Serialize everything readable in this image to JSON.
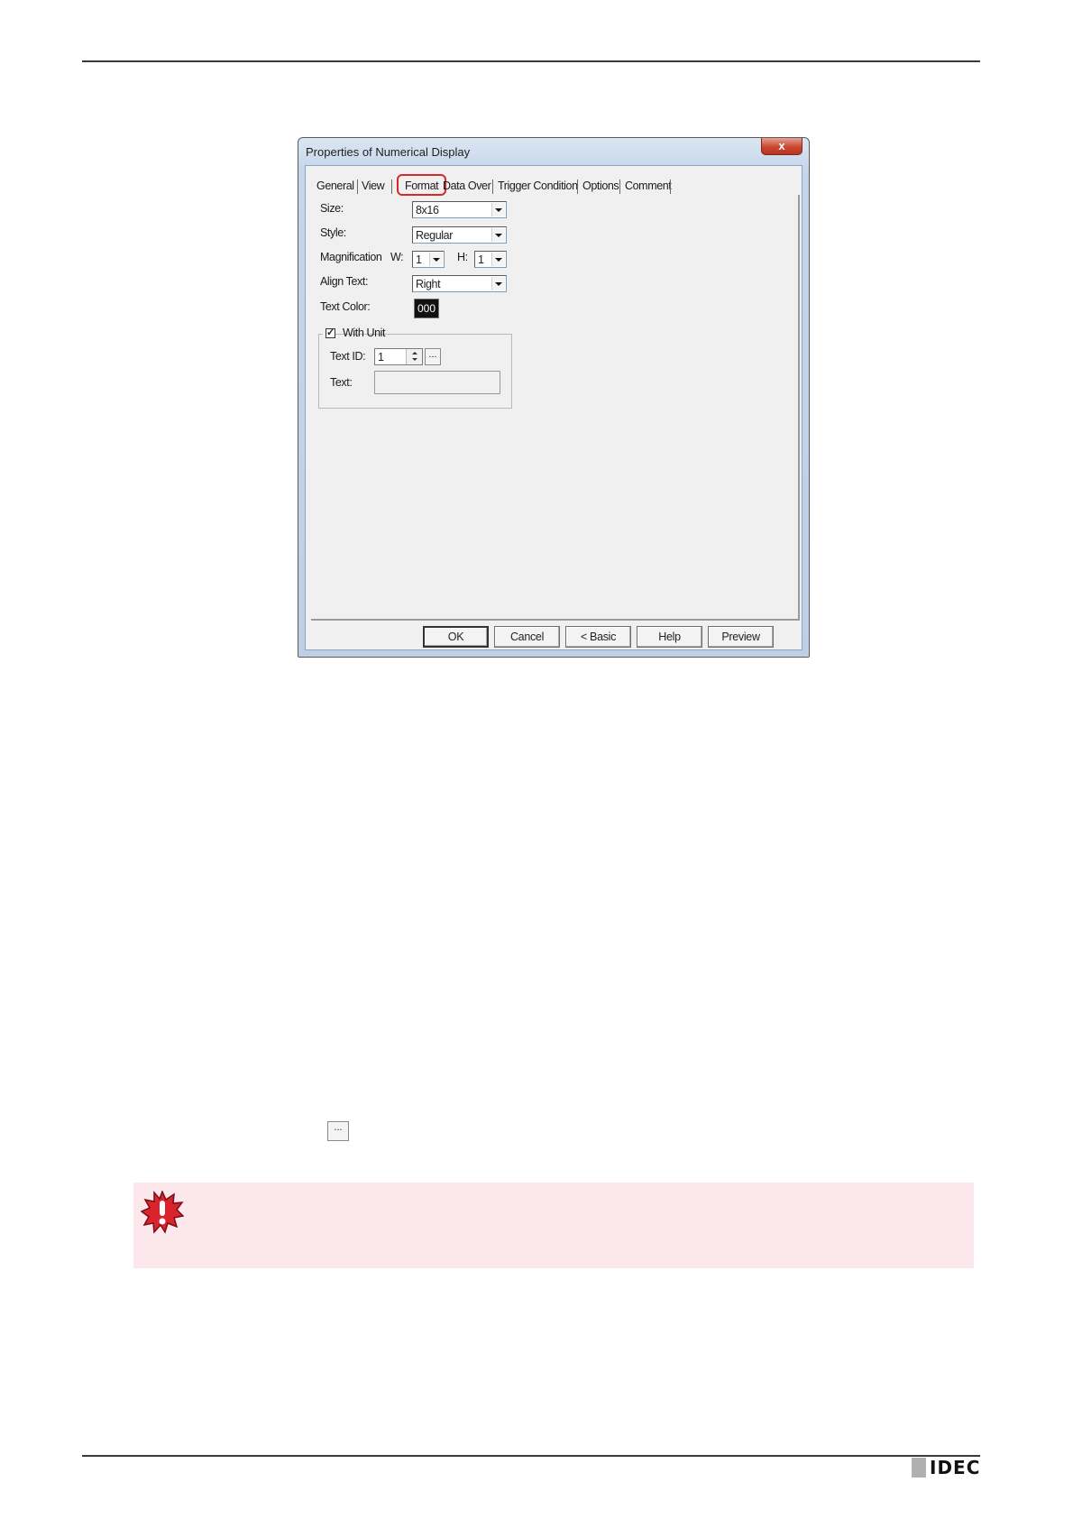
{
  "dialog": {
    "title": "Properties of Numerical Display",
    "close_glyph": "x",
    "tabs": [
      "General",
      "View",
      "Format",
      "Data Over",
      "Trigger Condition",
      "Options",
      "Comment"
    ],
    "active_tab": "Format",
    "size": {
      "label": "Size:",
      "value": "8x16"
    },
    "style": {
      "label": "Style:",
      "value": "Regular"
    },
    "magnification": {
      "label": "Magnification",
      "w_label": "W:",
      "w_value": "1",
      "h_label": "H:",
      "h_value": "1"
    },
    "align_text": {
      "label": "Align Text:",
      "value": "Right"
    },
    "text_color": {
      "label": "Text Color:",
      "value": "000",
      "swatch": "#111111"
    },
    "with_unit": {
      "label": "With Unit",
      "checked": true,
      "text_id_label": "Text ID:",
      "text_id_value": "1",
      "browse_label": "...",
      "text_label": "Text:",
      "text_value": ""
    },
    "buttons": {
      "ok": "OK",
      "cancel": "Cancel",
      "basic": "< Basic",
      "help": "Help",
      "preview": "Preview"
    }
  },
  "body": {
    "browse_button_label": "..."
  },
  "caution": {
    "icon": "caution-burst-icon",
    "background": "#fce7ec"
  },
  "footer": {
    "logo_text": "IDEC"
  }
}
